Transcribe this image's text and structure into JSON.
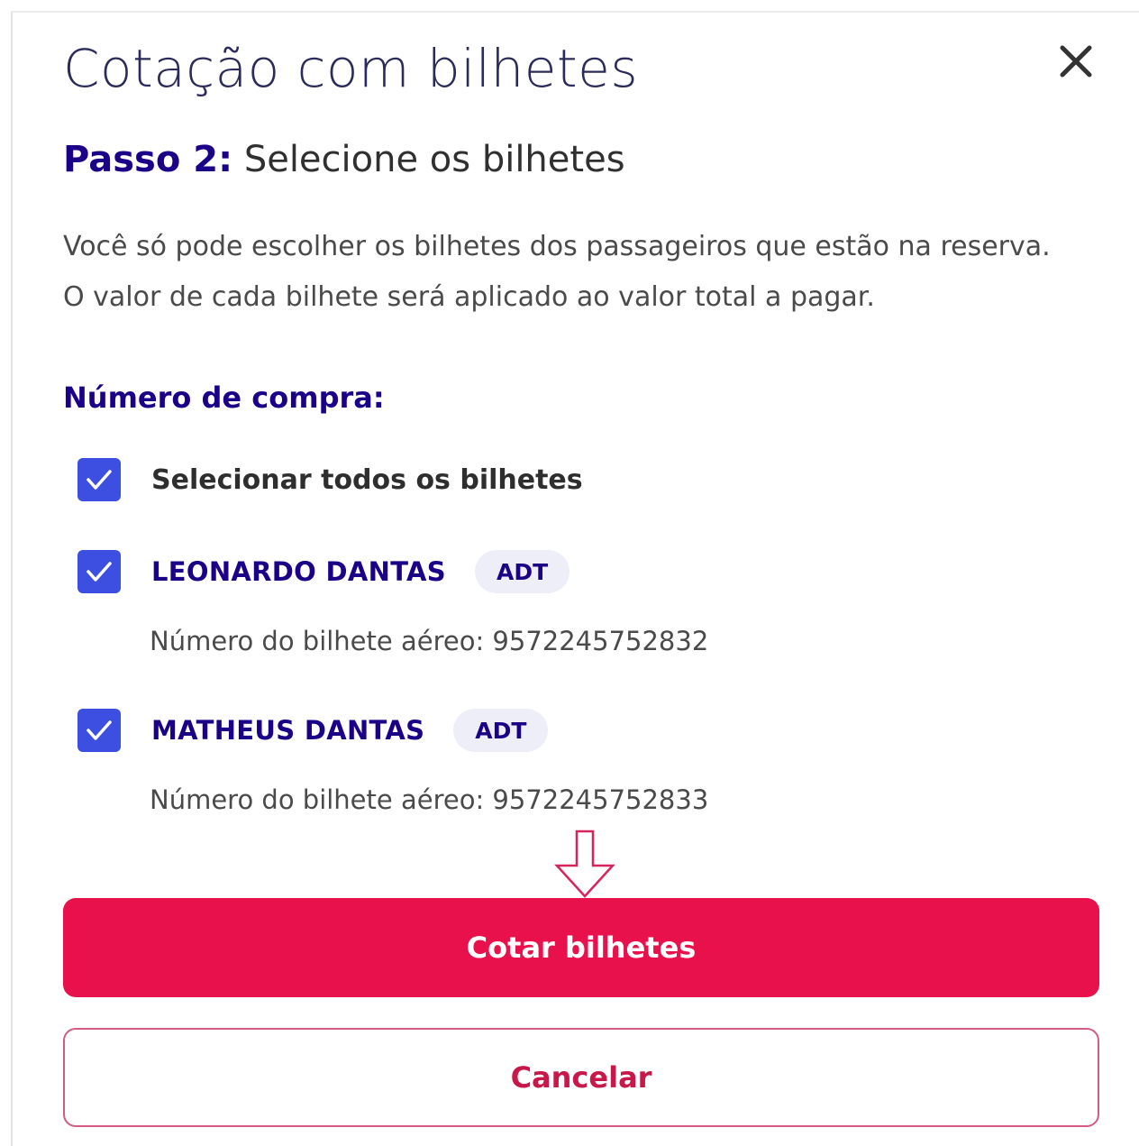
{
  "modal": {
    "title": "Cotação com bilhetes",
    "step": {
      "label": "Passo 2:",
      "text": "Selecione os bilhetes"
    },
    "description": [
      "Você só pode escolher os bilhetes dos passageiros que estão na reserva.",
      "O valor de cada bilhete será aplicado ao valor total a pagar."
    ],
    "purchase_label": "Número de compra:",
    "select_all": {
      "label": "Selecionar todos os bilhetes",
      "checked": true
    },
    "passengers": [
      {
        "name": "LEONARDO DANTAS",
        "type": "ADT",
        "ticket_text": "Número do bilhete aéreo: 9572245752832",
        "checked": true
      },
      {
        "name": "MATHEUS DANTAS",
        "type": "ADT",
        "ticket_text": "Número do bilhete aéreo: 9572245752833",
        "checked": true
      }
    ],
    "primary_button": "Cotar bilhetes",
    "secondary_button": "Cancelar"
  },
  "colors": {
    "brand_indigo": "#1b0088",
    "checkbox_blue": "#3d4fe0",
    "primary_red": "#e8114b",
    "hint_arrow": "#d6255a"
  },
  "icons": {
    "close": "close-icon",
    "check": "checkmark-icon",
    "hint": "arrow-down-outline-icon"
  }
}
